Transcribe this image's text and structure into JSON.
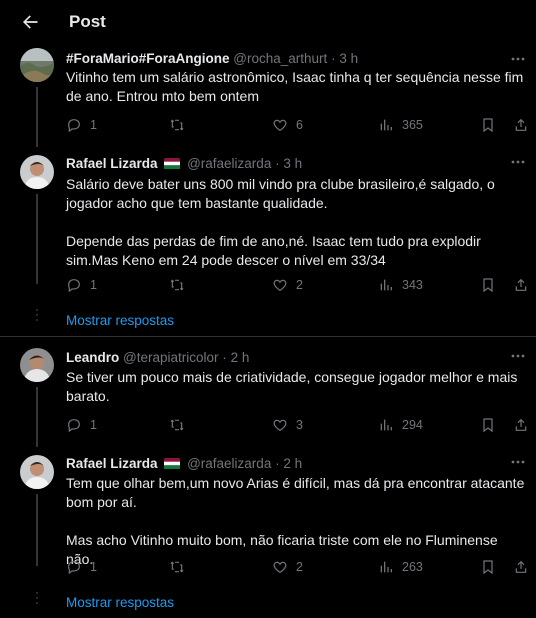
{
  "header": {
    "title": "Post"
  },
  "tweets": [
    {
      "name": "#ForaMario#ForaAngione",
      "handle": "@rocha_arthurt",
      "dot": "·",
      "time": "3 h",
      "text": "Vitinho tem um salário astronômico, Isaac tinha q ter sequência nesse fim de ano. Entrou mto bem ontem",
      "replies": "1",
      "retweets": "",
      "likes": "6",
      "views": "365"
    },
    {
      "name": "Rafael Lizarda",
      "handle": "@rafaelizarda",
      "dot": "·",
      "time": "3 h",
      "text": "Salário deve bater uns 800 mil vindo pra clube brasileiro,é salgado, o jogador acho que tem bastante qualidade.\n\nDepende das perdas de fim de ano,né. Isaac tem tudo pra explodir sim.Mas Keno em 24 pode descer o nível em 33/34",
      "replies": "1",
      "retweets": "",
      "likes": "2",
      "views": "343"
    },
    {
      "name": "Leandro",
      "handle": "@terapiatricolor",
      "dot": "·",
      "time": "2 h",
      "text": "Se tiver um pouco mais de criatividade, consegue jogador melhor e mais barato.",
      "replies": "1",
      "retweets": "",
      "likes": "3",
      "views": "294"
    },
    {
      "name": "Rafael Lizarda",
      "handle": "@rafaelizarda",
      "dot": "·",
      "time": "2 h",
      "text": "Tem que olhar bem,um novo Arias é difícil, mas dá pra encontrar atacante bom por aí.\n\nMas acho Vitinho muito bom, não ficaria triste com ele no Fluminense não.",
      "replies": "1",
      "retweets": "",
      "likes": "2",
      "views": "263"
    }
  ],
  "show_replies_label": "Mostrar respostas",
  "colors": {
    "background": "#000000",
    "text": "#e7e9ea",
    "muted": "#71767b",
    "link": "#1d9bf0",
    "separator": "#2f3336"
  }
}
